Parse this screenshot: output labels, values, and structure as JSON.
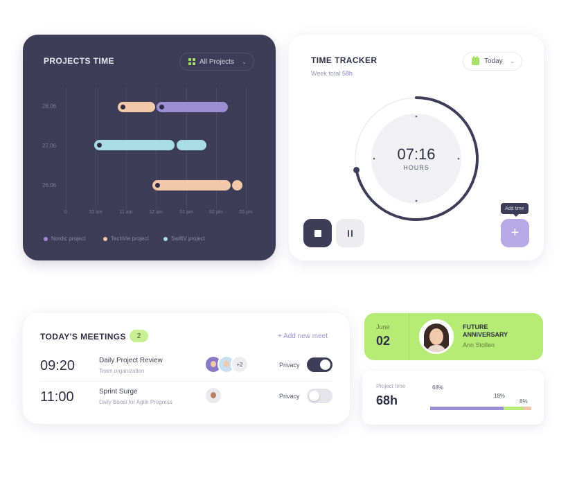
{
  "projects_time": {
    "title": "PROJECTS TIME",
    "filter_label": "All Projects",
    "filter_icon": "grid-icon",
    "y_labels": [
      "28.06",
      "27.06",
      "26.06"
    ],
    "x_labels": [
      "0",
      "10 am",
      "11 am",
      "12 am",
      "01 pm",
      "02 pm",
      "03 pm"
    ],
    "legend": [
      {
        "label": "Nordic project",
        "color": "#9c8ed2"
      },
      {
        "label": "TechVie project",
        "color": "#f1c8a8"
      },
      {
        "label": "SwiftV project",
        "color": "#a8dde8"
      }
    ],
    "colors": {
      "card_bg": "#3d3d58",
      "accent": "#a7e06a"
    }
  },
  "chart_data": {
    "type": "gantt",
    "rows": [
      "28.06",
      "27.06",
      "26.06"
    ],
    "x_axis": [
      "0",
      "10 am",
      "11 am",
      "12 am",
      "01 pm",
      "02 pm",
      "03 pm"
    ],
    "series": [
      {
        "name": "Nordic project",
        "color": "#9c8ed2"
      },
      {
        "name": "TechVie project",
        "color": "#f1c8a8"
      },
      {
        "name": "SwiftV project",
        "color": "#a8dde8"
      }
    ]
  },
  "time_tracker": {
    "title": "TIME TRACKER",
    "week_label": "Week total",
    "week_value": "58h",
    "period": "Today",
    "period_icon": "calendar-icon",
    "clock_time": "07:16",
    "clock_unit": "HOURS",
    "progress_fraction": 0.72,
    "add_tooltip": "Add time",
    "buttons": {
      "stop": "stop-icon",
      "pause": "pause-icon",
      "add": "+"
    }
  },
  "meetings": {
    "title": "TODAY'S MEETINGS",
    "count": "2",
    "add_label": "+ Add new meet",
    "items": [
      {
        "time": "09:20",
        "title": "Daily Project Review",
        "subtitle": "Team organization",
        "extra": "+2",
        "privacy": "Privacy",
        "privacy_on": true
      },
      {
        "time": "11:00",
        "title": "Sprint Surge",
        "subtitle": "Daily Boost for Agile Progress",
        "privacy": "Privacy",
        "privacy_on": false
      }
    ]
  },
  "anniversary": {
    "month": "June",
    "day": "02",
    "label": "FUTURE ANNIVERSARY",
    "name": "Ann Stollen",
    "color": "#b6ec76"
  },
  "project_time": {
    "label": "Project time",
    "value": "68h",
    "segments": [
      {
        "percent": "68%",
        "fraction": 0.68,
        "color": "#9c8ed2"
      },
      {
        "percent": "18%",
        "fraction": 0.18,
        "color": "#b6ec76"
      },
      {
        "percent": "8%",
        "fraction": 0.08,
        "color": "#f1c8a8"
      }
    ]
  }
}
